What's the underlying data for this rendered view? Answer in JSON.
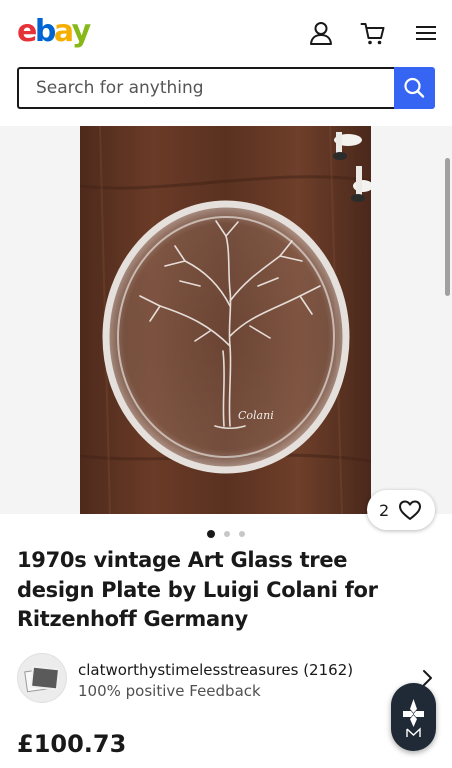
{
  "header": {
    "logo_letters": [
      "e",
      "b",
      "a",
      "y"
    ],
    "logo_colors": [
      "#e53238",
      "#0064d2",
      "#f5af02",
      "#86b817"
    ],
    "account_icon": "person-icon",
    "cart_icon": "cart-icon",
    "menu_icon": "hamburger-menu-icon"
  },
  "search": {
    "placeholder": "Search for anything",
    "button_icon": "search-icon",
    "accent": "#3665f3"
  },
  "gallery": {
    "image_subject": "engraved glass plate with tree design on wooden table",
    "signature": "Colani",
    "dots_total": 3,
    "active_dot": 1
  },
  "watch": {
    "count": "2",
    "icon": "heart-icon"
  },
  "listing": {
    "title": "1970s vintage Art Glass tree design Plate by Luigi Colani for Ritzenhoff Germany",
    "price": "£100.73"
  },
  "seller": {
    "name_with_count": "clatworthystimelesstreasures (2162)",
    "feedback": "100% positive Feedback",
    "avatar_icon": "photo-placeholder-icon",
    "chevron_icon": "chevron-right-icon"
  },
  "assistant": {
    "icon": "assistant-logo-icon"
  }
}
